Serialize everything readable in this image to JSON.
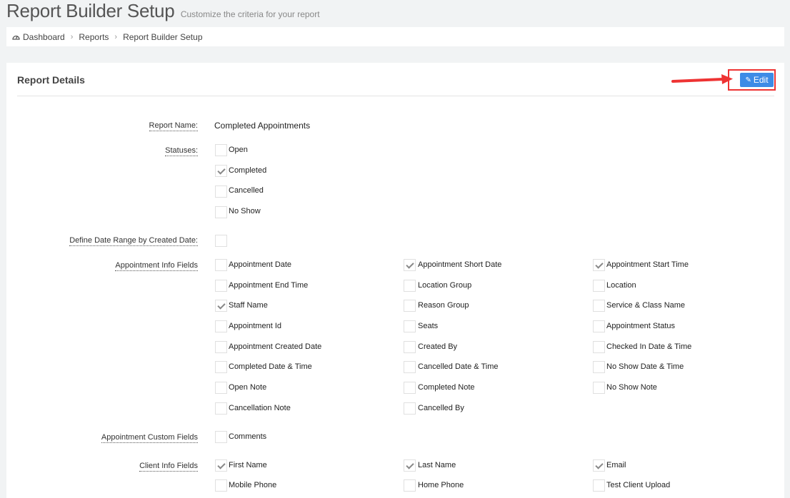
{
  "header": {
    "title": "Report Builder Setup",
    "subtitle": "Customize the criteria for your report"
  },
  "breadcrumb": [
    "Dashboard",
    "Reports",
    "Report Builder Setup"
  ],
  "panel": {
    "title": "Report Details",
    "edit_label": "Edit"
  },
  "report_name": {
    "label": "Report Name:",
    "value": "Completed Appointments"
  },
  "statuses": {
    "label": "Statuses:",
    "items": [
      {
        "label": "Open",
        "checked": false
      },
      {
        "label": "Completed",
        "checked": true
      },
      {
        "label": "Cancelled",
        "checked": false
      },
      {
        "label": "No Show",
        "checked": false
      }
    ]
  },
  "date_range": {
    "label": "Define Date Range by Created Date:",
    "checked": false
  },
  "appointment_info": {
    "label": "Appointment Info Fields",
    "items": [
      {
        "label": "Appointment Date",
        "checked": false
      },
      {
        "label": "Appointment Short Date",
        "checked": true
      },
      {
        "label": "Appointment Start Time",
        "checked": true
      },
      {
        "label": "Appointment End Time",
        "checked": false
      },
      {
        "label": "Location Group",
        "checked": false
      },
      {
        "label": "Location",
        "checked": false
      },
      {
        "label": "Staff Name",
        "checked": true
      },
      {
        "label": "Reason Group",
        "checked": false
      },
      {
        "label": "Service & Class Name",
        "checked": false
      },
      {
        "label": "Appointment Id",
        "checked": false
      },
      {
        "label": "Seats",
        "checked": false
      },
      {
        "label": "Appointment Status",
        "checked": false
      },
      {
        "label": "Appointment Created Date",
        "checked": false
      },
      {
        "label": "Created By",
        "checked": false
      },
      {
        "label": "Checked In Date & Time",
        "checked": false
      },
      {
        "label": "Completed Date & Time",
        "checked": false
      },
      {
        "label": "Cancelled Date & Time",
        "checked": false
      },
      {
        "label": "No Show Date & Time",
        "checked": false
      },
      {
        "label": "Open Note",
        "checked": false
      },
      {
        "label": "Completed Note",
        "checked": false
      },
      {
        "label": "No Show Note",
        "checked": false
      },
      {
        "label": "Cancellation Note",
        "checked": false
      },
      {
        "label": "Cancelled By",
        "checked": false
      }
    ]
  },
  "custom_fields": {
    "label": "Appointment Custom Fields",
    "items": [
      {
        "label": "Comments",
        "checked": false
      }
    ]
  },
  "client_info": {
    "label": "Client Info Fields",
    "items": [
      {
        "label": "First Name",
        "checked": true
      },
      {
        "label": "Last Name",
        "checked": true
      },
      {
        "label": "Email",
        "checked": true
      },
      {
        "label": "Mobile Phone",
        "checked": false
      },
      {
        "label": "Home Phone",
        "checked": false
      },
      {
        "label": "Test Client Upload",
        "checked": false
      }
    ]
  },
  "colors": {
    "accent": "#3d8be6",
    "highlight": "#e33333"
  }
}
